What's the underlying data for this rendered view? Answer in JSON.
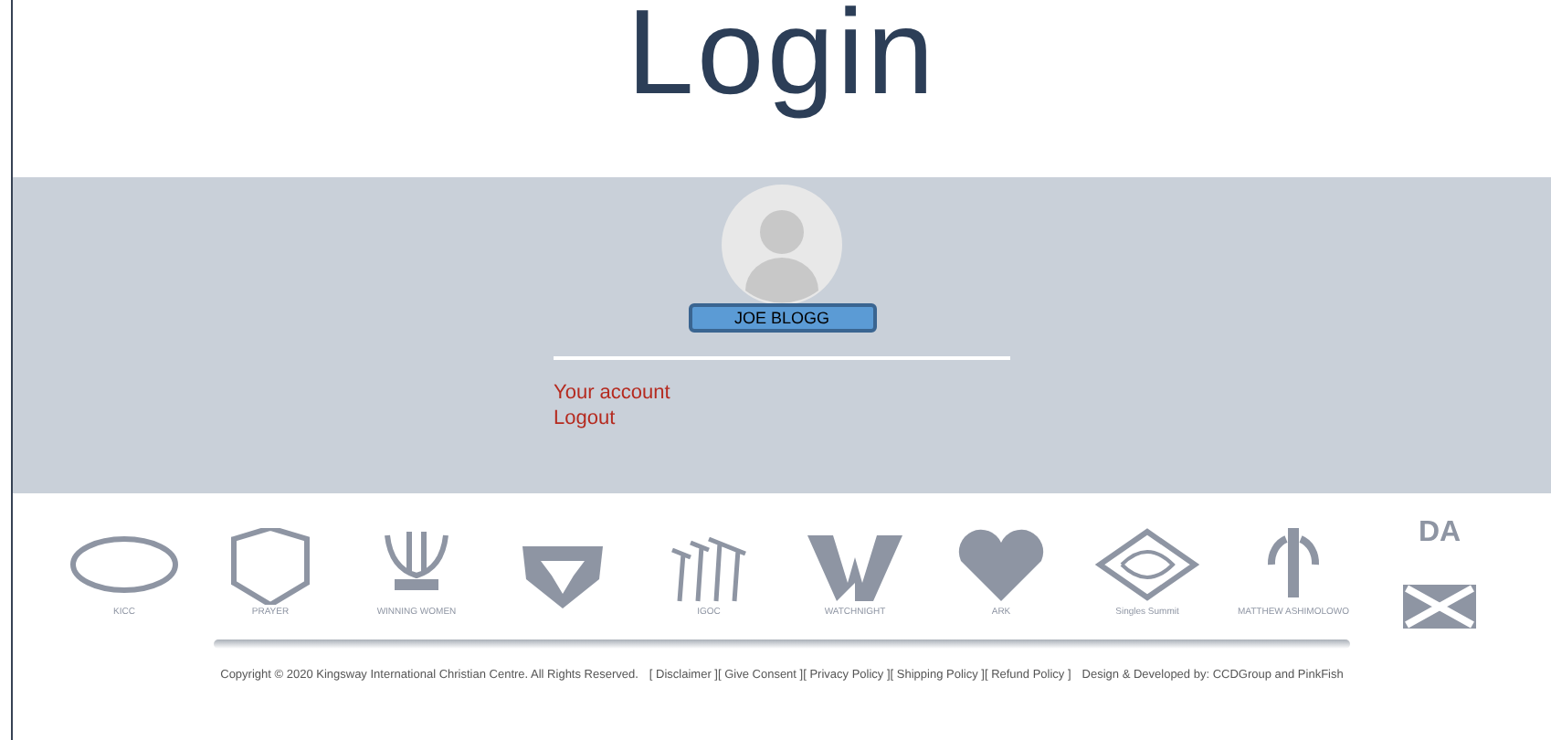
{
  "title": "Login",
  "profile": {
    "name": "JOE BLOGG",
    "links": [
      "Your account",
      "Logout"
    ]
  },
  "logos": [
    {
      "kind": "oval",
      "text": "KICC"
    },
    {
      "kind": "badge",
      "text": "PRAYER"
    },
    {
      "kind": "crown",
      "text": "WINNING WOMEN"
    },
    {
      "kind": "shield"
    },
    {
      "kind": "figures",
      "text": "IGOC"
    },
    {
      "kind": "w",
      "text": "WATCHNIGHT"
    },
    {
      "kind": "heart",
      "text": "ARK"
    },
    {
      "kind": "diamond",
      "text": "Singles Summit"
    },
    {
      "kind": "pillar",
      "text": "MATTHEW ASHIMOLOWO"
    },
    {
      "kind": "dax",
      "text": "DA"
    }
  ],
  "footer": {
    "copyright": "Copyright © 2020 Kingsway International Christian Centre. All Rights Reserved.",
    "links": [
      "[ Disclaimer ]",
      "[ Give Consent ]",
      "[ Privacy Policy ]",
      "[ Shipping Policy ]",
      "[ Refund Policy ]"
    ],
    "credit": "Design & Developed by: CCDGroup and PinkFish"
  }
}
